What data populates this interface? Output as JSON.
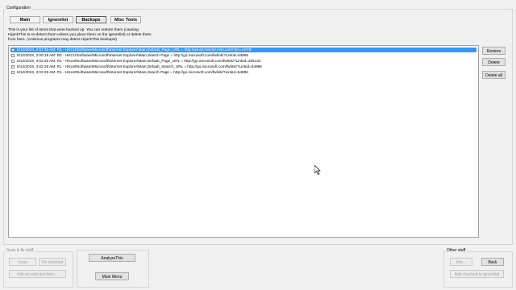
{
  "config_group": {
    "label": "Configuration"
  },
  "tabs": [
    {
      "label": "Main",
      "active": false
    },
    {
      "label": "Ignorelist",
      "active": false
    },
    {
      "label": "Backups",
      "active": true
    },
    {
      "label": "Misc Tools",
      "active": false
    }
  ],
  "description": "This is your list of items that were backed up. You can restore them (causing HijackThis to re-detect them unless you place them on the ignorelist) or delete them from here. (Antivirus programs may detect HijackThis backups!)",
  "backups": [
    {
      "text": "5/12/2019, 2:57:36 AM: R1 - HKCU\\Software\\Microsoft\\Internet Explorer\\Main,Default_Page_URL = http://asus17win10.msn.com/?pc=ASTE",
      "selected": true,
      "checked": false
    },
    {
      "text": "5/12/2019, 3:00:18 AM: R0 - HKCU\\Software\\Microsoft\\Internet Explorer\\Main,Search Page = http://go.microsoft.com/fwlink/?LinkId=54896",
      "selected": false,
      "checked": false
    },
    {
      "text": "5/12/2019, 3:02:28 AM: R1 - HKLM\\Software\\Microsoft\\Internet Explorer\\Main,Default_Page_URL = http://go.microsoft.com/fwlink/?LinkId=255141",
      "selected": false,
      "checked": false
    },
    {
      "text": "5/12/2019, 3:02:28 AM: R1 - HKLM\\Software\\Microsoft\\Internet Explorer\\Main,Default_Search_URL = http://go.microsoft.com/fwlink/?LinkId=54896",
      "selected": false,
      "checked": false
    },
    {
      "text": "5/12/2019, 3:02:28 AM: R1 - HKLM\\Software\\Microsoft\\Internet Explorer\\Main,Search Page = http://go.microsoft.com/fwlink/?LinkId=54896",
      "selected": false,
      "checked": false
    }
  ],
  "side_buttons": {
    "restore": "Restore",
    "delete": "Delete",
    "delete_all": "Delete all"
  },
  "scan_fix_group": {
    "label": "Scan & fix stuff",
    "scan": "Scan",
    "fix_checked": "Fix checked",
    "info_selected": "Info on selected item..."
  },
  "analyze_button": "AnalyzeThis",
  "main_menu_button": "Main Menu",
  "other_group": {
    "label": "Other stuff",
    "info": "Info...",
    "back": "Back",
    "add_checked": "Add checked to ignorelist"
  }
}
